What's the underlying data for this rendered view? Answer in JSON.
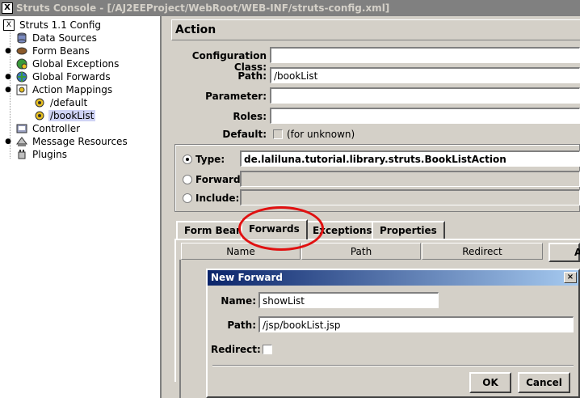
{
  "window": {
    "title": "Struts Console - [/AJ2EEProject/WebRoot/WEB-INF/struts-config.xml]"
  },
  "tree": {
    "root": "Struts 1.1 Config",
    "items": [
      {
        "label": "Data Sources"
      },
      {
        "label": "Form Beans"
      },
      {
        "label": "Global Exceptions"
      },
      {
        "label": "Global Forwards"
      },
      {
        "label": "Action Mappings"
      },
      {
        "label": "/default"
      },
      {
        "label": "/bookList"
      },
      {
        "label": "Controller"
      },
      {
        "label": "Message Resources"
      },
      {
        "label": "Plugins"
      }
    ]
  },
  "action": {
    "header": "Action",
    "config_class_label": "Configuration Class:",
    "config_class_value": "",
    "path_label": "Path:",
    "path_value": "/bookList",
    "parameter_label": "Parameter:",
    "parameter_value": "",
    "roles_label": "Roles:",
    "roles_value": "",
    "default_label": "Default:",
    "default_note": "(for unknown)",
    "type_label": "Type:",
    "type_value": "de.laliluna.tutorial.library.struts.BookListAction",
    "forward_label": "Forward:",
    "include_label": "Include:"
  },
  "tabs": [
    {
      "label": "Form Bean"
    },
    {
      "label": "Forwards"
    },
    {
      "label": "Exceptions"
    },
    {
      "label": "Properties"
    }
  ],
  "forwards_table": {
    "columns": [
      "Name",
      "Path",
      "Redirect"
    ],
    "side_button": "A"
  },
  "dialog": {
    "title": "New Forward",
    "name_label": "Name:",
    "name_value": "showList",
    "path_label": "Path:",
    "path_value": "/jsp/bookList.jsp",
    "redirect_label": "Redirect:",
    "ok_label": "OK",
    "cancel_label": "Cancel",
    "close_glyph": "×"
  },
  "colors": {
    "annotation": "#e01010",
    "dialog_title_start": "#0a246a",
    "dialog_title_end": "#a6caf0",
    "selection": "#cfd3f5"
  }
}
